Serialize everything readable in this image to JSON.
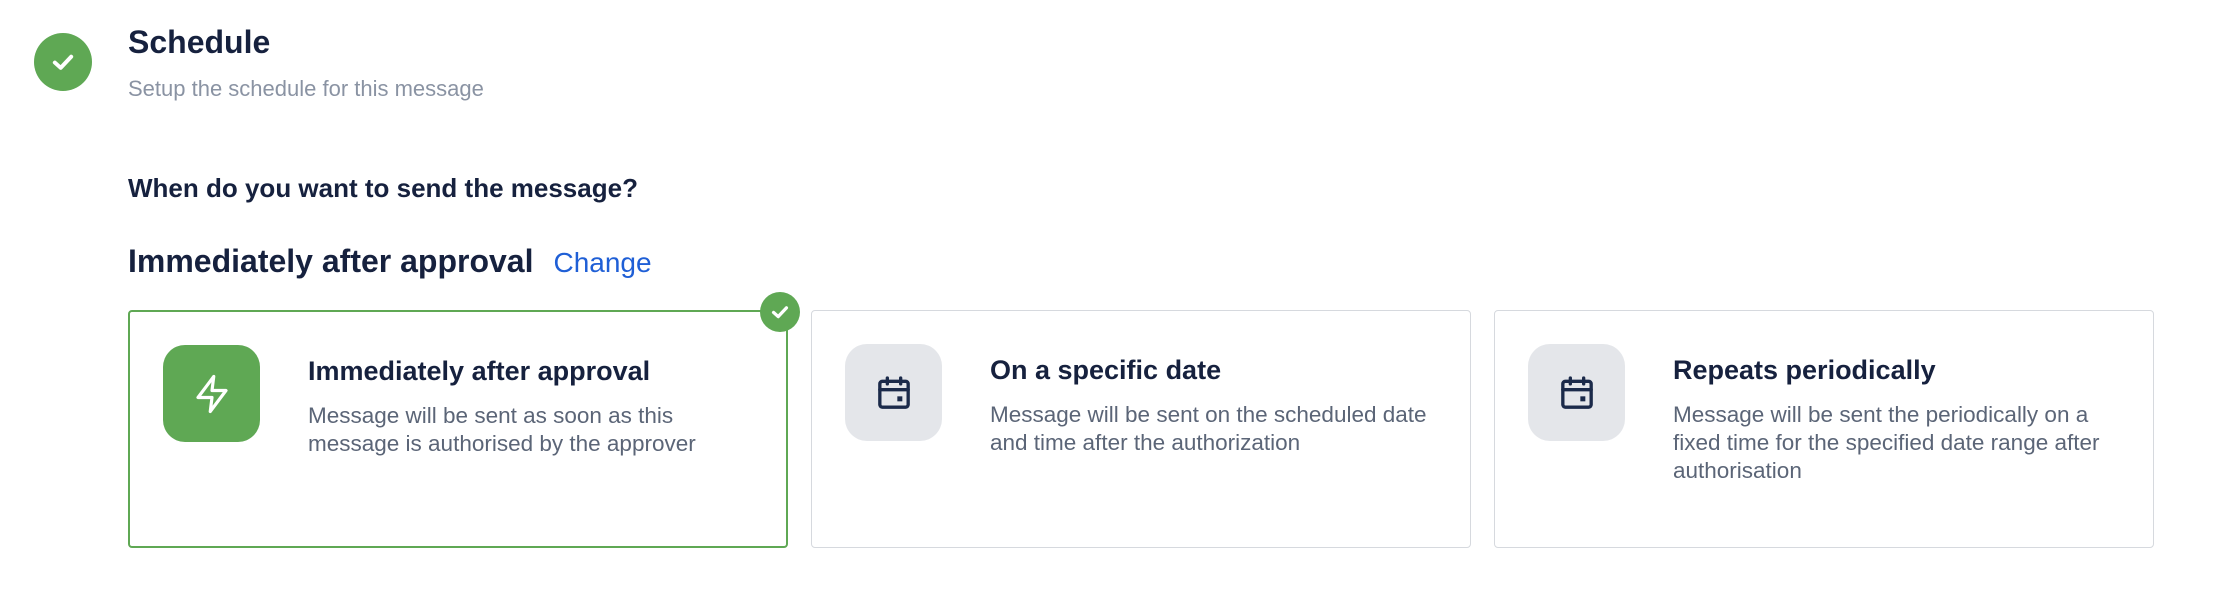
{
  "section": {
    "title": "Schedule",
    "subtitle": "Setup the schedule for this message",
    "step_icon": "check-icon",
    "accent_color": "#5fa854"
  },
  "question": "When do you want to send the message?",
  "current_selection": {
    "value": "Immediately after approval",
    "change_label": "Change",
    "link_color": "#1f5fd6"
  },
  "options": [
    {
      "title": "Immediately after approval",
      "description": "Message will be sent as soon as this message is authorised by the approver",
      "icon": "lightning-icon",
      "selected": true
    },
    {
      "title": "On a specific date",
      "description": "Message will be sent on the scheduled date and time after the authorization",
      "icon": "calendar-icon",
      "selected": false
    },
    {
      "title": "Repeats periodically",
      "description": "Message will be sent the periodically on a fixed time for the specified date range after authorisation",
      "icon": "calendar-icon",
      "selected": false
    }
  ]
}
